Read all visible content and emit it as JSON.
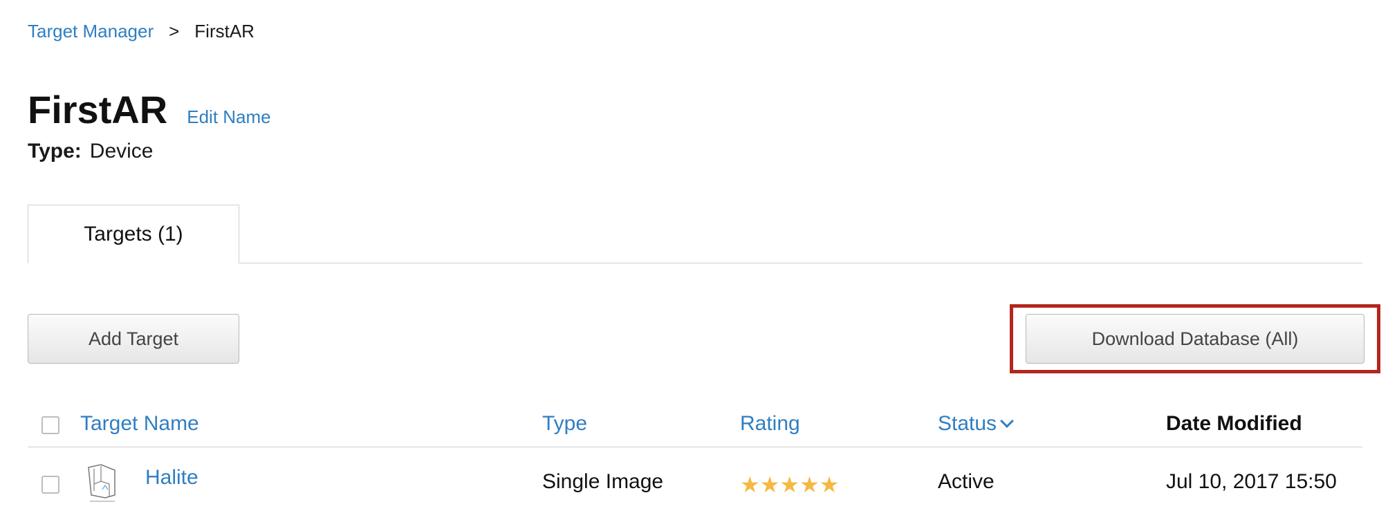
{
  "breadcrumb": {
    "root": "Target Manager",
    "separator": ">",
    "current": "FirstAR"
  },
  "header": {
    "title": "FirstAR",
    "edit_label": "Edit Name",
    "type_label": "Type:",
    "type_value": "Device"
  },
  "tabs": [
    {
      "label": "Targets (1)",
      "active": true
    }
  ],
  "toolbar": {
    "add_label": "Add Target",
    "download_label": "Download Database (All)"
  },
  "table": {
    "columns": {
      "name": "Target Name",
      "type": "Type",
      "rating": "Rating",
      "status": "Status",
      "date": "Date Modified"
    },
    "rows": [
      {
        "name": "Halite",
        "type": "Single Image",
        "rating": 5,
        "rating_stars": "★★★★★",
        "status": "Active",
        "date": "Jul 10, 2017 15:50"
      }
    ]
  },
  "colors": {
    "link": "#2f7ec1",
    "star": "#f5b942",
    "highlight": "#b3261e"
  },
  "icons": {
    "status_sort": "chevron-down-icon",
    "thumbnail": "target-thumbnail-icon"
  }
}
